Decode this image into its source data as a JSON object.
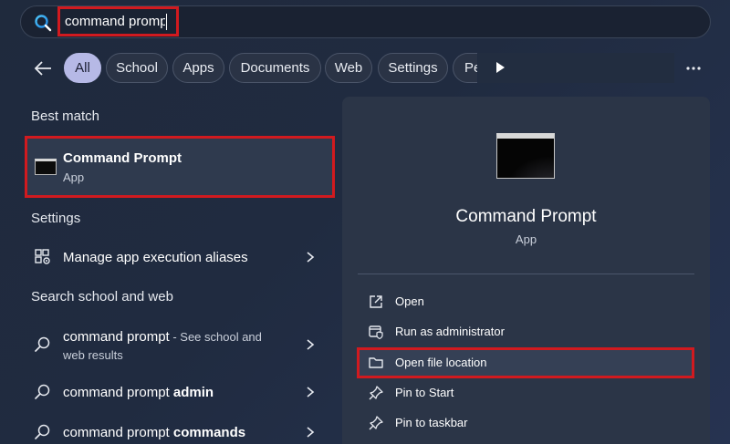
{
  "search": {
    "value": "command prompt"
  },
  "filters": {
    "chips": [
      "All",
      "School",
      "Apps",
      "Documents",
      "Web",
      "Settings",
      "Pe"
    ]
  },
  "best_match": {
    "header": "Best match",
    "title": "Command Prompt",
    "subtitle": "App"
  },
  "settings": {
    "header": "Settings",
    "items": [
      {
        "label": "Manage app execution aliases"
      }
    ]
  },
  "web": {
    "header": "Search school and web",
    "items": [
      {
        "prefix": "command prompt",
        "bold": "",
        "suffix": " - See school and",
        "suffix2": "web results"
      },
      {
        "prefix": "command prompt ",
        "bold": "admin",
        "suffix": "",
        "suffix2": ""
      },
      {
        "prefix": "command prompt ",
        "bold": "commands",
        "suffix": "",
        "suffix2": ""
      }
    ]
  },
  "details": {
    "title": "Command Prompt",
    "subtitle": "App",
    "actions": [
      {
        "label": "Open",
        "icon": "open-external-icon"
      },
      {
        "label": "Run as administrator",
        "icon": "shield-icon"
      },
      {
        "label": "Open file location",
        "icon": "folder-icon"
      },
      {
        "label": "Pin to Start",
        "icon": "pin-icon"
      },
      {
        "label": "Pin to taskbar",
        "icon": "pin-icon"
      }
    ]
  },
  "colors": {
    "accent_chip": "#b6b9e6",
    "highlight_border": "#d11a1f",
    "panel": "#2b3547"
  }
}
